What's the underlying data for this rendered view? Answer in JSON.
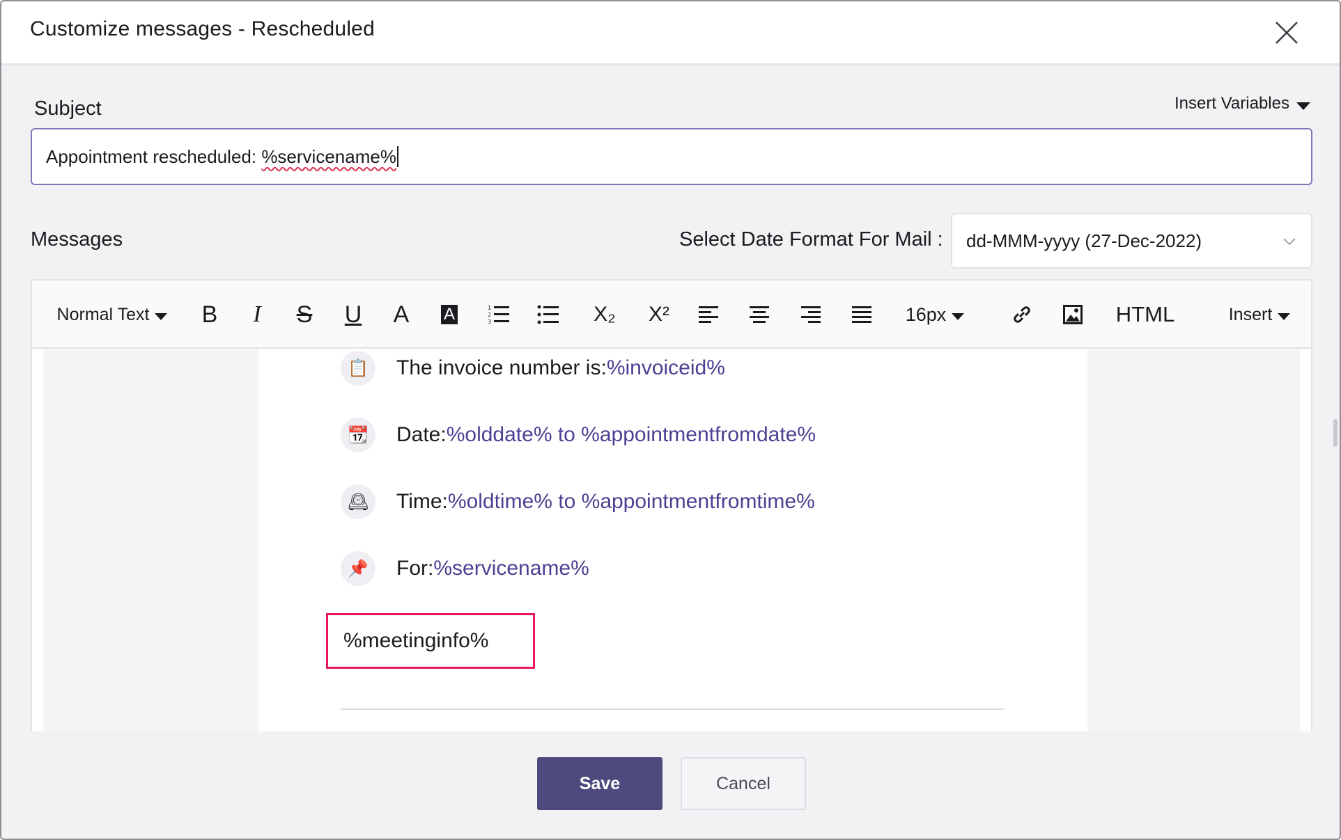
{
  "dialog": {
    "title": "Customize messages - Rescheduled"
  },
  "subject": {
    "label": "Subject",
    "insert_variables": "Insert Variables",
    "value_prefix": "Appointment rescheduled: ",
    "value_variable": "%servicename%"
  },
  "messages": {
    "label": "Messages",
    "date_format_label": "Select Date Format For Mail :",
    "date_format_value": "dd-MMM-yyyy (27-Dec-2022)"
  },
  "toolbar": {
    "paragraph_style": "Normal Text",
    "bold": "B",
    "italic": "I",
    "strike": "S",
    "underline": "U",
    "font_color": "A",
    "highlight": "A",
    "subscript": "X₂",
    "superscript": "X²",
    "font_size": "16px",
    "html": "HTML",
    "insert": "Insert",
    "icons": [
      "paragraph-style",
      "bold",
      "italic",
      "strikethrough",
      "underline",
      "font-color",
      "background-color",
      "ordered-list",
      "unordered-list",
      "subscript",
      "superscript",
      "align-left",
      "align-center",
      "align-right",
      "align-justify",
      "font-size",
      "link",
      "image",
      "html",
      "insert"
    ]
  },
  "body": {
    "rows": [
      {
        "icon": "clipboard-icon",
        "glyph": "📋",
        "label": "The invoice number is:",
        "value": "%invoiceid%"
      },
      {
        "icon": "calendar-icon",
        "glyph": "📆",
        "label": "Date:",
        "value": "%olddate% to %appointmentfromdate%"
      },
      {
        "icon": "clock-icon",
        "glyph": "🕰",
        "label": "Time:",
        "value": "%oldtime% to %appointmentfromtime%"
      },
      {
        "icon": "pushpin-icon",
        "glyph": "📌",
        "label": "For:",
        "value": "%servicename%"
      }
    ],
    "meeting_info": "%meetinginfo%"
  },
  "footer": {
    "save": "Save",
    "cancel": "Cancel"
  },
  "colors": {
    "accent": "#4e4a7e",
    "variable_text": "#4e3f93",
    "highlight_border": "#e6185e"
  }
}
